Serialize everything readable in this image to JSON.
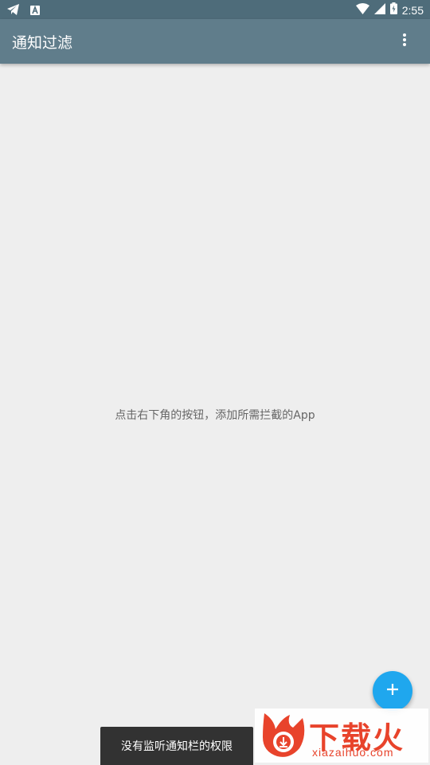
{
  "status_bar": {
    "time": "2:55",
    "left_icons": [
      "telegram-icon",
      "app-notification-icon"
    ],
    "right_icons": [
      "wifi-icon",
      "signal-icon",
      "battery-icon"
    ]
  },
  "app_bar": {
    "title": "通知过滤",
    "menu_icon": "more-vert-icon",
    "color": "#607d8b"
  },
  "main": {
    "empty_hint": "点击右下角的按钮，添加所需拦截的App",
    "background": "#eeeeee"
  },
  "fab": {
    "icon": "plus-icon",
    "color": "#1fa7ee"
  },
  "snackbar": {
    "message": "没有监听通知栏的权限"
  },
  "watermark": {
    "brand_cn": "下载火",
    "brand_url": "xiazaihuo.com",
    "color": "#e8432b"
  }
}
